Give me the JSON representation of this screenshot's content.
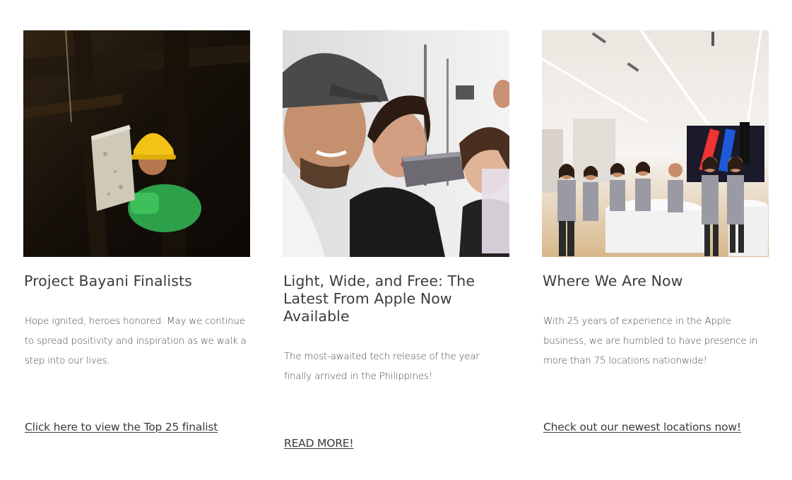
{
  "cards": [
    {
      "title": "Project Bayani Finalists",
      "description": "Hope ignited, heroes honored. May we continue to spread positivity and inspiration as we walk a step into our lives.",
      "link": "Click here to view the Top 25 finalist"
    },
    {
      "title": "Light, Wide, and Free: The Latest From Apple Now Available",
      "description": "The most-awaited tech release of the year finally arrived in the Philippines!",
      "link": "READ MORE!"
    },
    {
      "title": "Where We Are Now",
      "description": "With 25 years of experience in the Apple business, we are humbled to have presence in more than 75 locations nationwide!",
      "link": "Check out our newest locations now!"
    }
  ],
  "colors": {
    "text": "#3c3c3c",
    "background": "#ffffff"
  }
}
